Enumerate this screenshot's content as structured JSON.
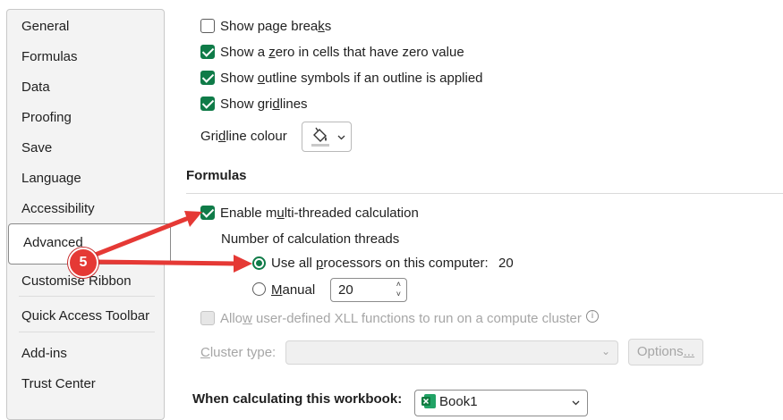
{
  "sidebar": {
    "items": [
      {
        "label": "General"
      },
      {
        "label": "Formulas"
      },
      {
        "label": "Data"
      },
      {
        "label": "Proofing"
      },
      {
        "label": "Save"
      },
      {
        "label": "Language"
      },
      {
        "label": "Accessibility"
      },
      {
        "label": "Advanced",
        "selected": true
      },
      {
        "label": "Customise Ribbon"
      },
      {
        "label": "Quick Access Toolbar"
      },
      {
        "label": "Add-ins"
      },
      {
        "label": "Trust Center"
      }
    ]
  },
  "display": {
    "show_page_breaks": {
      "pre": "Show page brea",
      "u": "k",
      "post": "s",
      "checked": false
    },
    "show_zero": {
      "pre": "Show a ",
      "u": "z",
      "post": "ero in cells that have zero value",
      "checked": true
    },
    "show_outline": {
      "pre": "Show ",
      "u": "o",
      "post": "utline symbols if an outline is applied",
      "checked": true
    },
    "show_gridlines": {
      "pre": "Show gri",
      "u": "d",
      "post": "lines",
      "checked": true
    },
    "gridline_colour": {
      "pre": "Gri",
      "u": "d",
      "post": "line colour"
    }
  },
  "formulas": {
    "title": "Formulas",
    "multithread": {
      "pre": "Enable m",
      "u": "u",
      "post": "lti-threaded calculation",
      "checked": true
    },
    "threads_label": "Number of calculation threads",
    "use_all": {
      "pre": "Use all ",
      "u": "p",
      "post": "rocessors on this computer:",
      "value": "20",
      "selected": true
    },
    "manual": {
      "pre": "",
      "u": "M",
      "post": "anual",
      "value": "20",
      "selected": false
    },
    "xll": {
      "pre": "Allo",
      "u": "w",
      "post": " user-defined XLL functions to run on a compute cluster",
      "checked": false
    },
    "cluster_type": {
      "pre": "",
      "u": "C",
      "post": "luster type:",
      "value": ""
    },
    "options_button": {
      "pre": "Options",
      "u": "...",
      "post": ""
    }
  },
  "workbook": {
    "label": "When calculating this workbook:",
    "value": "Book1"
  },
  "annotation": {
    "badge": "5"
  },
  "colors": {
    "accent": "#0f7b48",
    "arrow": "#e53935"
  }
}
